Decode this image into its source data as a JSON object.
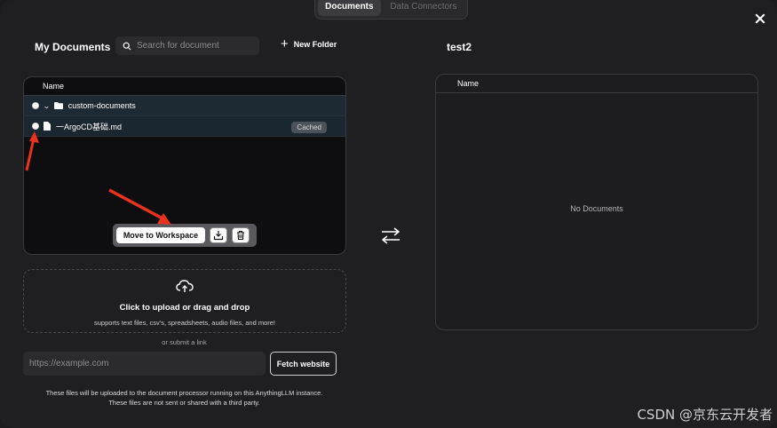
{
  "tabs": [
    {
      "label": "Documents",
      "active": true
    },
    {
      "label": "Data Connectors",
      "active": false
    }
  ],
  "my_documents": {
    "title": "My Documents",
    "search_placeholder": "Search for document",
    "new_folder_label": "New Folder",
    "column_header": "Name",
    "folder": {
      "name": "custom-documents"
    },
    "file": {
      "name": "一ArgoCD基础.md",
      "badge": "Cached"
    },
    "actions": {
      "move_label": "Move to Workspace",
      "embed_icon": "embed-icon",
      "delete_icon": "trash-icon"
    }
  },
  "upload": {
    "title": "Click to upload or drag and drop",
    "subtitle": "supports text files, csv's, spreadsheets, audio files, and more!",
    "or_link": "or submit a link",
    "url_placeholder": "https://example.com",
    "fetch_label": "Fetch website",
    "notice_line1": "These files will be uploaded to the document processor running on this AnythingLLM instance.",
    "notice_line2": "These files are not sent or shared with a third party."
  },
  "workspace": {
    "title": "test2",
    "column_header": "Name",
    "empty_text": "No Documents"
  },
  "watermark": "CSDN @京东云开发者",
  "colors": {
    "annotation_arrow": "#e8321e",
    "row_highlight": "#1e2a33"
  }
}
